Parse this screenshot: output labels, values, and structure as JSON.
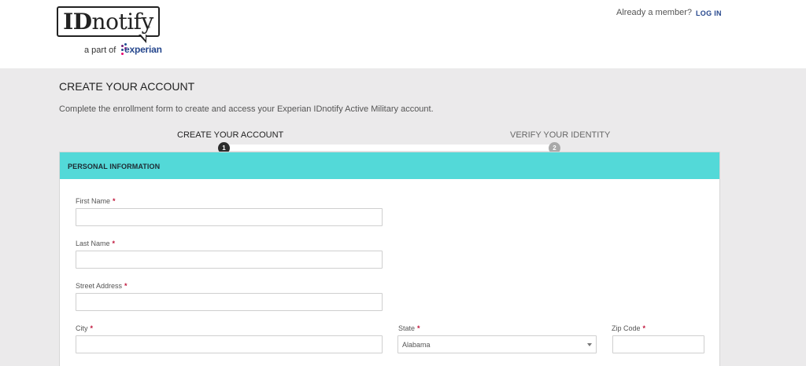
{
  "header": {
    "logo": {
      "brand": "IDnotify",
      "brand_id": "ID",
      "brand_rest": "notify",
      "trademark": "™",
      "icon": "speech-bubble-logo"
    },
    "partner": {
      "prefix": "a part of",
      "name": "experian",
      "icon": "experian-dots-logo"
    },
    "member_prompt": "Already a member?",
    "login_label": "LOG IN"
  },
  "main": {
    "title": "CREATE YOUR ACCOUNT",
    "intro": "Complete the enrollment form to create and access your Experian IDnotify Active Military account."
  },
  "steps": [
    {
      "label": "CREATE YOUR ACCOUNT",
      "number": "1",
      "active": true
    },
    {
      "label": "VERIFY YOUR IDENTITY",
      "number": "2",
      "active": false
    }
  ],
  "form": {
    "section_title": "PERSONAL INFORMATION",
    "required_marker": "*",
    "fields": {
      "first_name": {
        "label": "First Name",
        "value": "",
        "placeholder": ""
      },
      "last_name": {
        "label": "Last Name",
        "value": "",
        "placeholder": ""
      },
      "street_address": {
        "label": "Street Address",
        "value": "",
        "placeholder": ""
      },
      "city": {
        "label": "City",
        "value": "",
        "placeholder": ""
      },
      "state": {
        "label": "State",
        "value": "Alabama"
      },
      "zip_code": {
        "label": "Zip Code",
        "value": "",
        "placeholder": ""
      }
    }
  },
  "colors": {
    "section_header": "#53d9d8",
    "page_background": "#ebeaeb",
    "link": "#26478d",
    "required": "#c0163b",
    "step_active": "#2b2b2b",
    "step_inactive": "#a9a9a9"
  }
}
